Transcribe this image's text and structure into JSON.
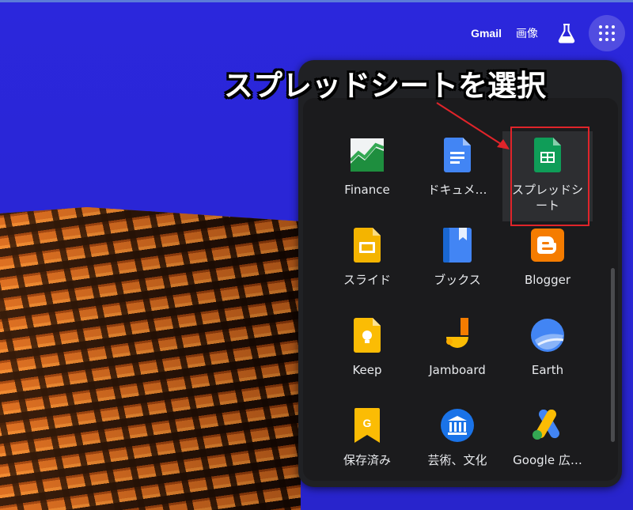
{
  "header": {
    "gmail": "Gmail",
    "images": "画像"
  },
  "annotation": {
    "text": "スプレッドシートを選択",
    "highlight_color": "#e0242a"
  },
  "apps": [
    {
      "label": "Finance",
      "icon": "finance-icon"
    },
    {
      "label": "ドキュメ…",
      "icon": "docs-icon"
    },
    {
      "label": "スプレッドシート",
      "icon": "sheets-icon",
      "selected": true
    },
    {
      "label": "スライド",
      "icon": "slides-icon"
    },
    {
      "label": "ブックス",
      "icon": "books-icon"
    },
    {
      "label": "Blogger",
      "icon": "blogger-icon"
    },
    {
      "label": "Keep",
      "icon": "keep-icon"
    },
    {
      "label": "Jamboard",
      "icon": "jamboard-icon"
    },
    {
      "label": "Earth",
      "icon": "earth-icon"
    },
    {
      "label": "保存済み",
      "icon": "saved-icon"
    },
    {
      "label": "芸術、文化",
      "icon": "arts-culture-icon"
    },
    {
      "label": "Google 広…",
      "icon": "google-ads-icon"
    }
  ]
}
